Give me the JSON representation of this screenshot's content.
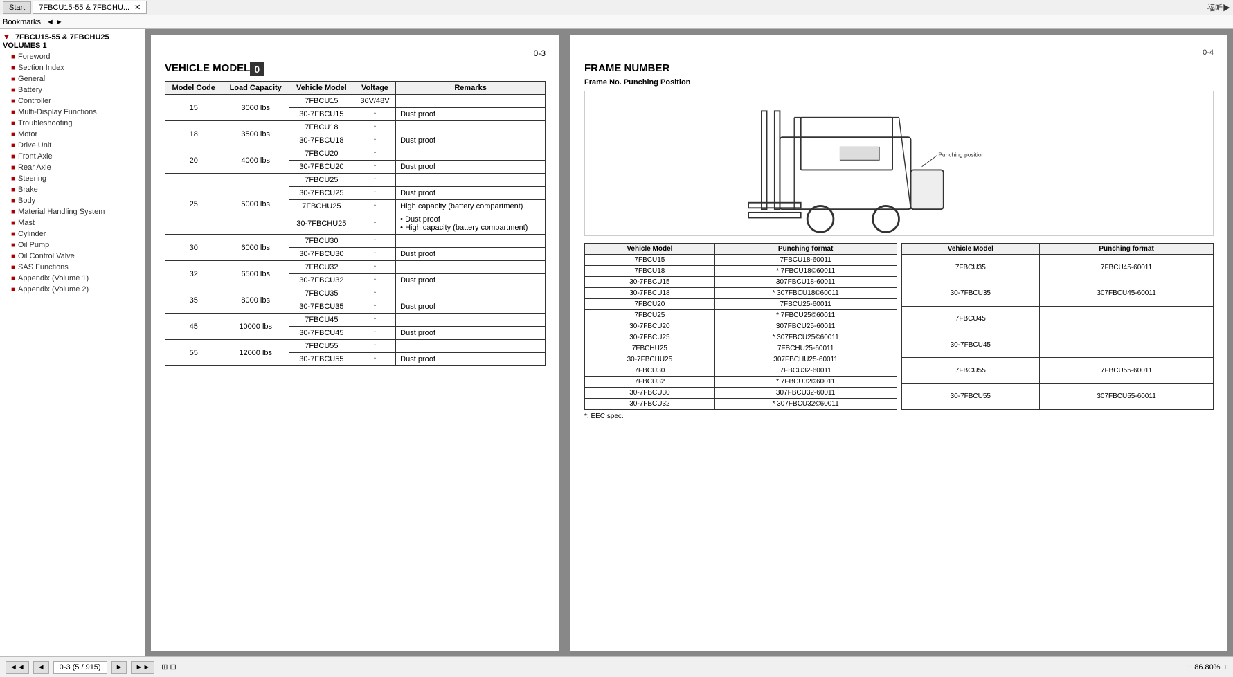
{
  "tabs": {
    "start_label": "Start",
    "main_label": "7FBCU15-55 & 7FBCHU...",
    "close_label": "✕"
  },
  "bookmarks": {
    "label": "Bookmarks",
    "nav_left": "◄",
    "nav_right": "►"
  },
  "sidebar": {
    "root_label": "7FBCU15-55 & 7FBCHU25 VOLUMES 1",
    "items": [
      {
        "label": "Foreword"
      },
      {
        "label": "Section Index"
      },
      {
        "label": "General"
      },
      {
        "label": "Battery"
      },
      {
        "label": "Controller"
      },
      {
        "label": "Multi-Display Functions"
      },
      {
        "label": "Troubleshooting"
      },
      {
        "label": "Motor"
      },
      {
        "label": "Drive Unit"
      },
      {
        "label": "Front Axle"
      },
      {
        "label": "Rear Axle"
      },
      {
        "label": "Steering"
      },
      {
        "label": "Brake"
      },
      {
        "label": "Body"
      },
      {
        "label": "Material Handling System"
      },
      {
        "label": "Mast"
      },
      {
        "label": "Cylinder"
      },
      {
        "label": "Oil Pump"
      },
      {
        "label": "Oil Control Valve"
      },
      {
        "label": "SAS Functions"
      },
      {
        "label": "Appendix (Volume 1)"
      },
      {
        "label": "Appendix (Volume 2)"
      }
    ]
  },
  "page_left": {
    "page_num": "0-3",
    "section_title": "VEHICLE MODEL",
    "highlight_num": "0",
    "table": {
      "headers": [
        "Model Code",
        "Load Capacity",
        "Vehicle Model",
        "Voltage",
        "Remarks"
      ],
      "rows": [
        {
          "code": "15",
          "capacity": "3000 lbs",
          "models": [
            {
              "model": "7FBCU15",
              "voltage": "36V/48V",
              "remarks": ""
            },
            {
              "model": "30-7FBCU15",
              "voltage": "↑",
              "remarks": "Dust proof"
            }
          ]
        },
        {
          "code": "18",
          "capacity": "3500 lbs",
          "models": [
            {
              "model": "7FBCU18",
              "voltage": "↑",
              "remarks": ""
            },
            {
              "model": "30-7FBCU18",
              "voltage": "↑",
              "remarks": "Dust proof"
            }
          ]
        },
        {
          "code": "20",
          "capacity": "4000 lbs",
          "models": [
            {
              "model": "7FBCU20",
              "voltage": "↑",
              "remarks": ""
            },
            {
              "model": "30-7FBCU20",
              "voltage": "↑",
              "remarks": "Dust proof"
            }
          ]
        },
        {
          "code": "25",
          "capacity": "5000 lbs",
          "models": [
            {
              "model": "7FBCU25",
              "voltage": "↑",
              "remarks": ""
            },
            {
              "model": "30-7FBCU25",
              "voltage": "↑",
              "remarks": "Dust proof"
            },
            {
              "model": "7FBCHU25",
              "voltage": "↑",
              "remarks": "High capacity (battery compartment)"
            },
            {
              "model": "30-7FBCHU25",
              "voltage": "↑",
              "remarks": "• Dust proof\n• High capacity (battery compartment)"
            }
          ]
        },
        {
          "code": "30",
          "capacity": "6000 lbs",
          "models": [
            {
              "model": "7FBCU30",
              "voltage": "↑",
              "remarks": ""
            },
            {
              "model": "30-7FBCU30",
              "voltage": "↑",
              "remarks": "Dust proof"
            }
          ]
        },
        {
          "code": "32",
          "capacity": "6500 lbs",
          "models": [
            {
              "model": "7FBCU32",
              "voltage": "↑",
              "remarks": ""
            },
            {
              "model": "30-7FBCU32",
              "voltage": "↑",
              "remarks": "Dust proof"
            }
          ]
        },
        {
          "code": "35",
          "capacity": "8000 lbs",
          "models": [
            {
              "model": "7FBCU35",
              "voltage": "↑",
              "remarks": ""
            },
            {
              "model": "30-7FBCU35",
              "voltage": "↑",
              "remarks": "Dust proof"
            }
          ]
        },
        {
          "code": "45",
          "capacity": "10000 lbs",
          "models": [
            {
              "model": "7FBCU45",
              "voltage": "↑",
              "remarks": ""
            },
            {
              "model": "30-7FBCU45",
              "voltage": "↑",
              "remarks": "Dust proof"
            }
          ]
        },
        {
          "code": "55",
          "capacity": "12000 lbs",
          "models": [
            {
              "model": "7FBCU55",
              "voltage": "↑",
              "remarks": ""
            },
            {
              "model": "30-7FBCU55",
              "voltage": "↑",
              "remarks": "Dust proof"
            }
          ]
        }
      ]
    }
  },
  "page_right": {
    "page_num": "0-4",
    "section_title": "FRAME NUMBER",
    "subtitle": "Frame No. Punching Position",
    "punching_label": "Punching position",
    "frame_table_left": {
      "headers": [
        "Vehicle Model",
        "Punching format"
      ],
      "rows": [
        [
          "7FBCU15",
          "7FBCU18-60011"
        ],
        [
          "7FBCU18",
          "* 7FBCU18©60011"
        ],
        [
          "30-7FBCU15",
          "307FBCU18-60011"
        ],
        [
          "30-7FBCU18",
          "* 307FBCU18©60011"
        ],
        [
          "7FBCU20",
          "7FBCU25-60011"
        ],
        [
          "7FBCU25",
          "* 7FBCU25©60011"
        ],
        [
          "30-7FBCU20",
          "307FBCU25-60011"
        ],
        [
          "30-7FBCU25",
          "* 307FBCU25©60011"
        ],
        [
          "7FBCHU25",
          "7FBCHU25-60011"
        ],
        [
          "30-7FBCHU25",
          "307FBCHU25-60011"
        ],
        [
          "7FBCU30",
          "7FBCU32-60011"
        ],
        [
          "7FBCU32",
          "* 7FBCU32©60011"
        ],
        [
          "30-7FBCU30",
          "307FBCU32-60011"
        ],
        [
          "30-7FBCU32",
          "* 307FBCU32©60011"
        ]
      ]
    },
    "frame_table_right": {
      "headers": [
        "Vehicle Model",
        "Punching format"
      ],
      "rows": [
        [
          "7FBCU35",
          "7FBCU45-60011"
        ],
        [
          "30-7FBCU35",
          "307FBCU45-60011"
        ],
        [
          "7FBCU45",
          ""
        ],
        [
          "30-7FBCU45",
          ""
        ],
        [
          "7FBCU55",
          "7FBCU55-60011"
        ],
        [
          "30-7FBCU55",
          "307FBCU55-60011"
        ]
      ]
    },
    "eec_note": "*: EEC spec."
  },
  "bottom": {
    "nav_first": "◄◄",
    "nav_prev": "◄",
    "page_indicator": "0-3 (5 / 915)",
    "nav_next": "►",
    "nav_last": "►►",
    "zoom_label": "86.80%",
    "zoom_out": "−",
    "zoom_in": "+"
  }
}
